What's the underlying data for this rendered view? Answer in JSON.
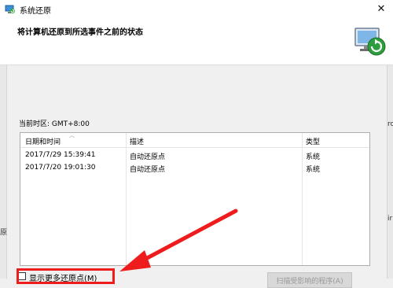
{
  "window": {
    "title": "系统还原",
    "close_symbol": "✕",
    "app_icon": "system-restore-icon"
  },
  "header": {
    "heading": "将计算机还原到所选事件之前的状态",
    "hero_icon": "system-restore-monitor-icon"
  },
  "timezone_label": "当前时区: GMT+8:00",
  "restore_points": {
    "columns": [
      "日期和时间",
      "描述",
      "类型"
    ],
    "rows": [
      [
        "2017/7/29 15:39:41",
        "自动还原点",
        "系统"
      ],
      [
        "2017/7/20 19:01:30",
        "自动还原点",
        "系统"
      ]
    ]
  },
  "show_more": {
    "label": "显示更多还原点(M)",
    "checked": false
  },
  "scan_button": {
    "label": "扫描受影响的程序(A)"
  },
  "edge_fragments": {
    "right_1": "ro",
    "right_2": "ir",
    "left_1": "原"
  },
  "colors": {
    "annotation_red": "#ee1c1c",
    "list_border": "#adadad",
    "background": "#f0f0f0"
  }
}
